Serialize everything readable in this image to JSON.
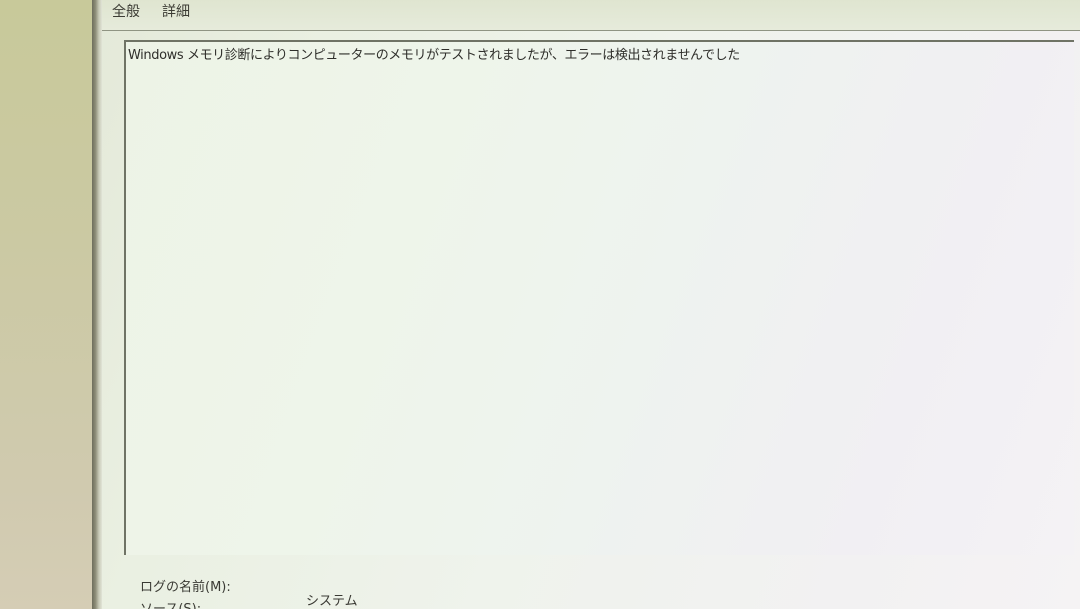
{
  "tabs": {
    "general": "全般",
    "details": "詳細"
  },
  "event": {
    "message": "Windows メモリ診断によりコンピューターのメモリがテストされましたが、エラーは検出されませんでした"
  },
  "fields": {
    "log_name_label": "ログの名前(M):",
    "log_name_value": "システム",
    "source_label": "ソース(S):"
  }
}
